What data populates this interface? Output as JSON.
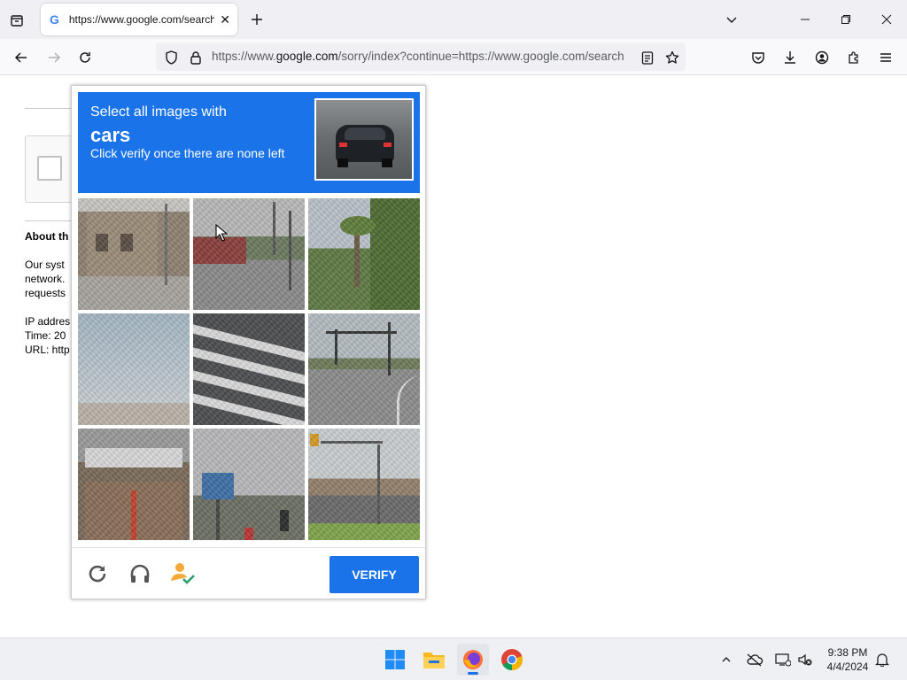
{
  "browser": {
    "tab": {
      "favicon": "G",
      "title": "https://www.google.com/search"
    },
    "url": {
      "prefix": "https://www.",
      "domain": "google.com",
      "path": "/sorry/index?continue=https://www.google.com/search"
    },
    "icons": [
      "tab-overview-icon",
      "new-tab-icon",
      "tab-list-icon",
      "minimize-icon",
      "restore-icon",
      "close-icon",
      "back-icon",
      "forward-icon",
      "reload-icon",
      "shield-icon",
      "lock-icon",
      "reader-view-icon",
      "bookmark-star-icon",
      "pocket-icon",
      "download-icon",
      "account-icon",
      "extensions-icon",
      "menu-icon"
    ]
  },
  "page": {
    "about_heading": "About th",
    "body_lines": [
      "Our syst",
      "network.",
      "requests"
    ],
    "meta_lines": [
      "IP addres",
      "Time: 20",
      "URL: http"
    ]
  },
  "captcha": {
    "header_line1": "Select all images with",
    "header_target": "cars",
    "header_line3": "Click verify once there are none left",
    "verify_label": "VERIFY",
    "colors": {
      "header": "#1a73e8",
      "verify": "#1a73e8"
    },
    "footer_icons": [
      "reload-icon",
      "audio-headphones-icon",
      "info-person-check-icon"
    ]
  },
  "taskbar": {
    "time": "9:38 PM",
    "date": "4/4/2024",
    "apps": [
      "windows-start-icon",
      "file-explorer-icon",
      "firefox-icon",
      "chrome-icon"
    ],
    "tray": [
      "chevron-up-icon",
      "onedrive-offline-icon",
      "network-icon",
      "volume-muted-icon",
      "notification-bell-icon"
    ]
  }
}
